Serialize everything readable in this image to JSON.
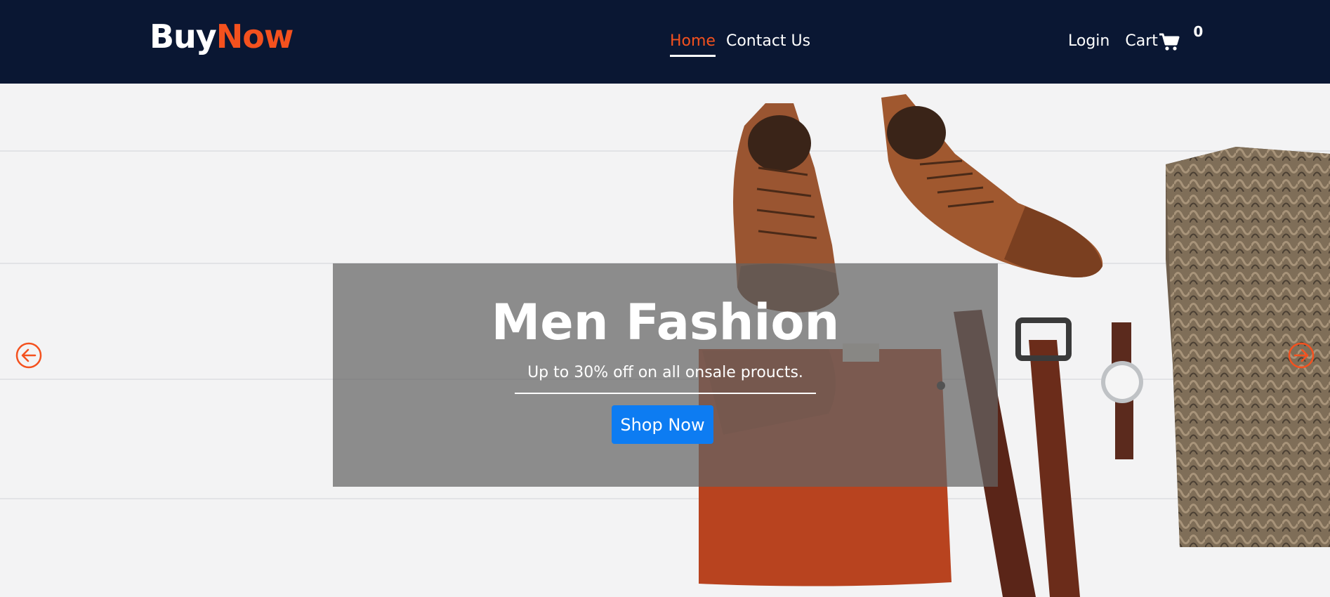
{
  "brand": {
    "part1": "Buy",
    "part2": "Now"
  },
  "nav": {
    "links": [
      {
        "label": "Home",
        "active": true
      },
      {
        "label": "Contact Us",
        "active": false
      }
    ],
    "login_label": "Login",
    "cart_label": "Cart",
    "cart_count": "0"
  },
  "hero": {
    "title": "Men Fashion",
    "subtitle": "Up to 30% off on all onsale proucts.",
    "button_label": "Shop Now"
  },
  "icons": {
    "cart": "cart-icon",
    "prev": "arrow-left-circle-icon",
    "next": "arrow-right-circle-icon"
  },
  "colors": {
    "navbar": "#0a1733",
    "accent": "#f4511e",
    "button": "#0d7cf2",
    "caption_overlay": "rgba(100,100,100,0.72)"
  }
}
